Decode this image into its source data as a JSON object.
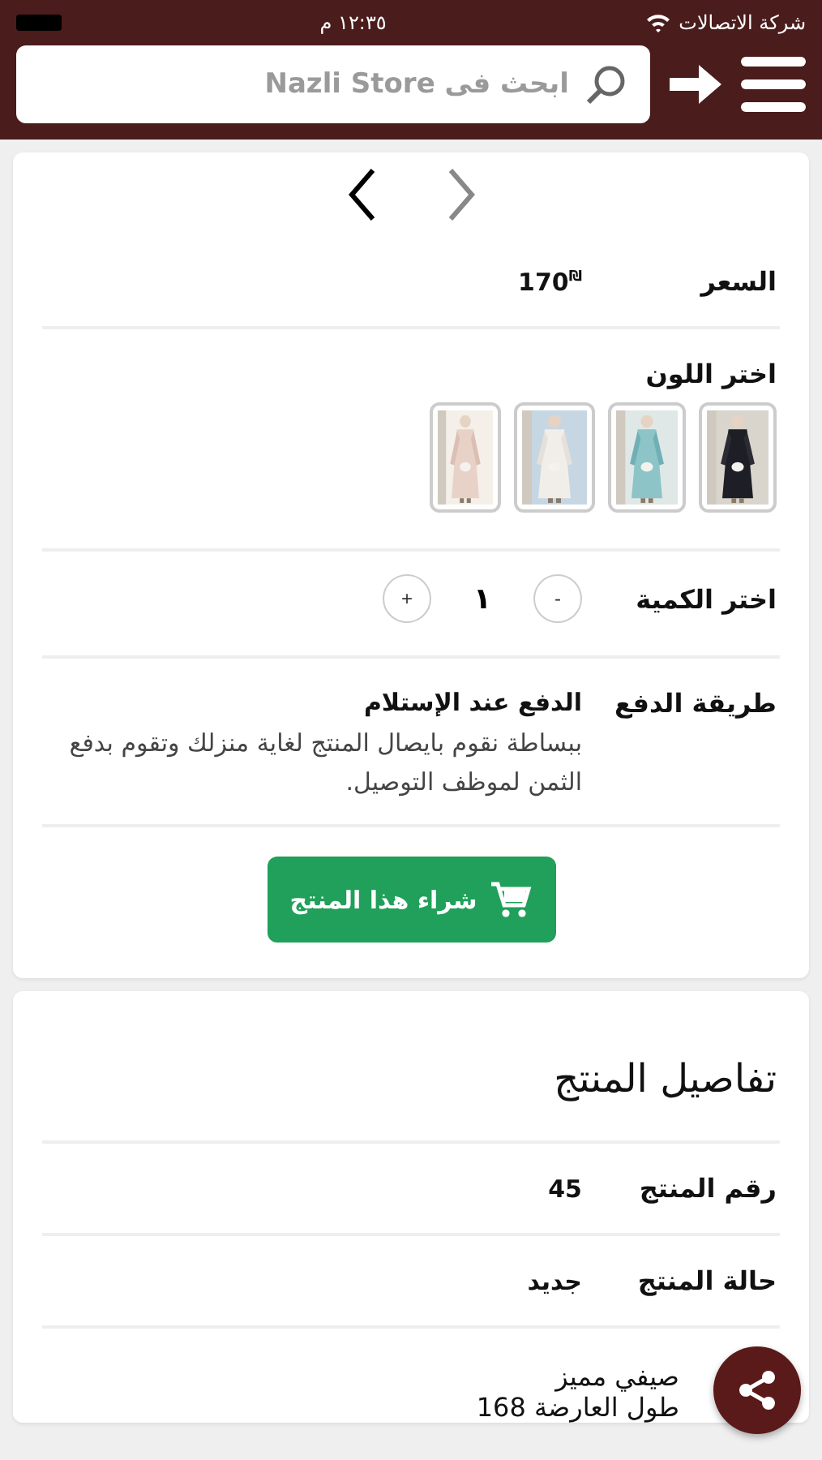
{
  "status_bar": {
    "carrier": "شركة الاتصالات",
    "time": "١٢:٣٥ م"
  },
  "header": {
    "search": {
      "placeholder": "ابحث فى Nazli Store"
    }
  },
  "product": {
    "gallery_nav": {
      "previous_disabled": true,
      "next_disabled": false
    },
    "price": {
      "label": "السعر",
      "value": "170$^{₪}$"
    },
    "color": {
      "label": "اختر اللون"
    },
    "quantity": {
      "label": "اختر الكمية",
      "minus": "-",
      "value": "١",
      "plus": "+"
    },
    "payment": {
      "label": "طريقة الدفع",
      "method": "الدفع عند الإستلام",
      "description": "ببساطة نقوم بايصال المنتج لغاية منزلك وتقوم بدفع الثمن لموظف التوصيل."
    },
    "buy_button": "شراء هذا المنتج"
  },
  "details": {
    "title": "تفاصيل المنتج",
    "rows": [
      {
        "label": "رقم المنتج",
        "value": "45"
      },
      {
        "label": "حالة المنتج",
        "value": "جديد"
      }
    ],
    "description_lines": [
      "صيفي مميز",
      "طول العارضة 168"
    ]
  }
}
